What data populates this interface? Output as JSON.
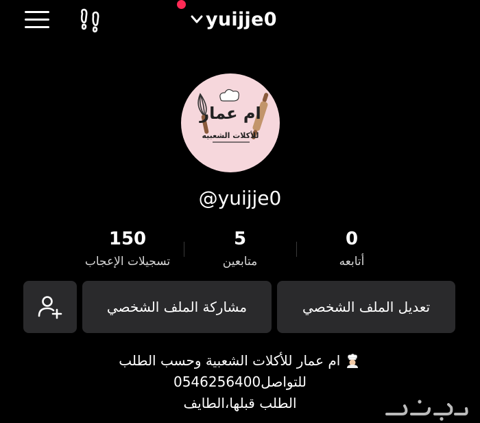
{
  "header": {
    "username": "yuijje0",
    "icons": [
      "menu-icon",
      "footprints-icon",
      "chevron-down-icon"
    ],
    "notification_dot_color": "#ff2a55"
  },
  "avatar": {
    "title": "ام عمار",
    "subtitle": "للأكلات الشعبيه",
    "background_color": "#f6d7dc"
  },
  "profile": {
    "handle": "@yuijje0"
  },
  "stats": [
    {
      "value": "150",
      "label": "تسجيلات الإعجاب"
    },
    {
      "value": "5",
      "label": "متابعين"
    },
    {
      "value": "0",
      "label": "أتابعه"
    }
  ],
  "actions": {
    "edit_profile": "تعديل الملف الشخصي",
    "share_profile": "مشاركة الملف الشخصي",
    "add_friend_icon": "add-user-icon"
  },
  "bio": {
    "line1": "ام عمار للأكلات الشعبية وحسب الطلب",
    "line2": "للتواصل0546256400",
    "line3": "الطلب قبلها،الطايف",
    "emoji_icon": "chef-icon"
  },
  "watermark": {
    "text": "حراج"
  }
}
